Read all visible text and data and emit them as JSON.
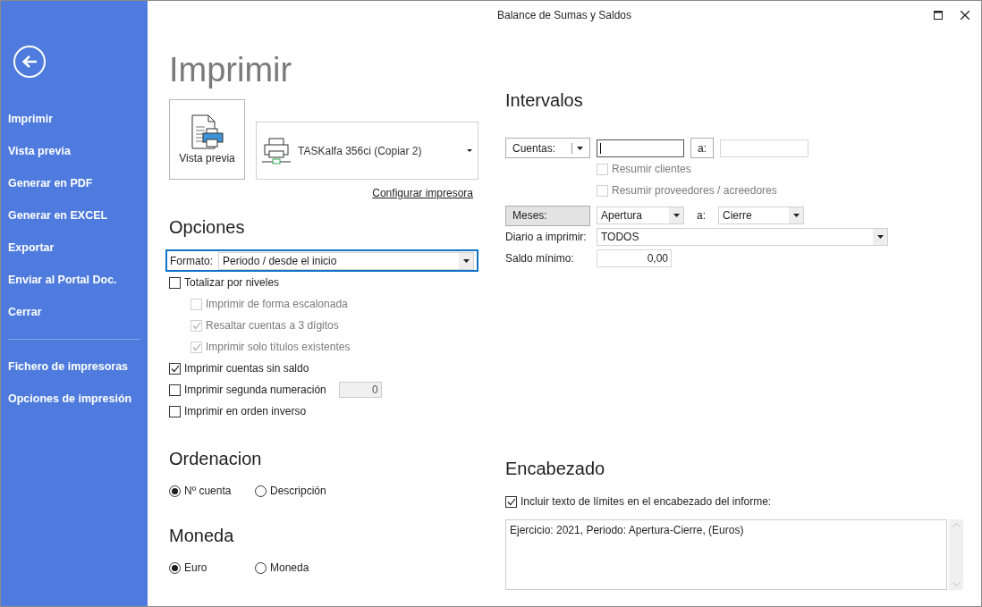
{
  "window": {
    "title": "Balance de Sumas y Saldos"
  },
  "sidebar": {
    "items": [
      {
        "label": "Imprimir"
      },
      {
        "label": "Vista previa"
      },
      {
        "label": "Generar en PDF"
      },
      {
        "label": "Generar en EXCEL"
      },
      {
        "label": "Exportar"
      },
      {
        "label": "Enviar al Portal Doc."
      },
      {
        "label": "Cerrar"
      }
    ],
    "secondary_items": [
      {
        "label": "Fichero de impresoras"
      },
      {
        "label": "Opciones de impresión"
      }
    ]
  },
  "page_title": "Imprimir",
  "preview_button": {
    "label": "Vista previa"
  },
  "printer": {
    "name": "TASKalfa 356ci (Copiar 2)"
  },
  "configure_link": "Configurar impresora",
  "options": {
    "heading": "Opciones",
    "format": {
      "label": "Formato:",
      "value": "Periodo / desde el inicio",
      "focused": true
    },
    "checks": [
      {
        "label": "Totalizar por niveles",
        "checked": false,
        "disabled": false,
        "children": [
          {
            "label": "Imprimir de forma escalonada",
            "checked": false,
            "disabled": true
          },
          {
            "label": "Resaltar cuentas a 3 dígitos",
            "checked": true,
            "disabled": true
          },
          {
            "label": "Imprimir solo títulos existentes",
            "checked": true,
            "disabled": true
          }
        ]
      },
      {
        "label": "Imprimir cuentas sin saldo",
        "checked": true,
        "disabled": false
      },
      {
        "label": "Imprimir segunda numeración",
        "checked": false,
        "disabled": false,
        "field": {
          "value": "0",
          "disabled": true
        }
      },
      {
        "label": "Imprimir en orden inverso",
        "checked": false,
        "disabled": false
      }
    ]
  },
  "ordering": {
    "heading": "Ordenacion",
    "options": [
      {
        "label": "Nº cuenta",
        "selected": true
      },
      {
        "label": "Descripción",
        "selected": false
      }
    ]
  },
  "currency": {
    "heading": "Moneda",
    "options": [
      {
        "label": "Euro",
        "selected": true
      },
      {
        "label": "Moneda",
        "selected": false
      }
    ]
  },
  "intervals": {
    "heading": "Intervalos",
    "accounts": {
      "selector": "Cuentas:",
      "to_label": "a:",
      "from_focused": true
    },
    "account_checks": [
      {
        "label": "Resumir clientes",
        "checked": false,
        "disabled": true
      },
      {
        "label": "Resumir proveedores / acreedores",
        "checked": false,
        "disabled": true
      }
    ],
    "months": {
      "label": "Meses:",
      "from": "Apertura",
      "to_label": "a:",
      "to": "Cierre"
    },
    "journal": {
      "label": "Diario a imprimir:",
      "value": "TODOS"
    },
    "min_balance": {
      "label": "Saldo mínimo:",
      "value": "0,00"
    }
  },
  "header": {
    "heading": "Encabezado",
    "include": {
      "label": "Incluir texto de límites en el encabezado del informe:",
      "checked": true
    },
    "text": "Ejercicio: 2021, Periodo: Apertura-Cierre, (Euros)"
  }
}
